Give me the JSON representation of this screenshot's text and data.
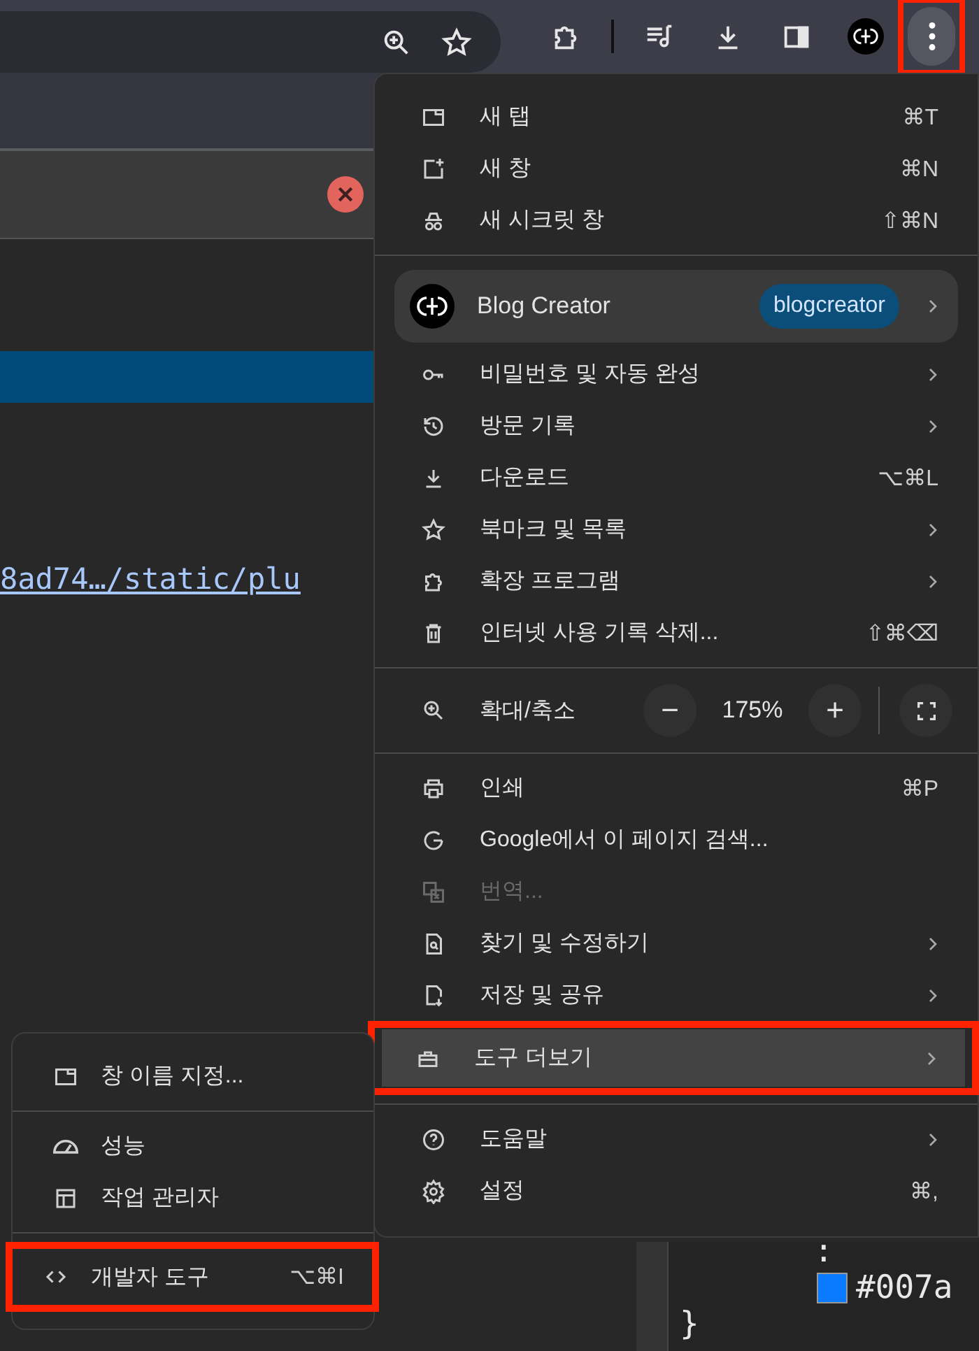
{
  "toolbar": {
    "menu_button": {
      "annotated": true
    }
  },
  "page": {
    "link_text": "8ad74…/static/plu",
    "code_lines": [
      ":",
      "#007a",
      "}"
    ]
  },
  "menu": {
    "sections": [
      {
        "items": [
          {
            "kind": "item",
            "label": "새 탭",
            "shortcut": "⌘T",
            "submenu": false,
            "disabled": false,
            "highlighted": false,
            "annotated": false
          },
          {
            "kind": "item",
            "label": "새 창",
            "shortcut": "⌘N",
            "submenu": false,
            "disabled": false,
            "highlighted": false,
            "annotated": false
          },
          {
            "kind": "item",
            "label": "새 시크릿 창",
            "shortcut": "⇧⌘N",
            "submenu": false,
            "disabled": false,
            "highlighted": false,
            "annotated": false
          }
        ]
      },
      {
        "items": [
          {
            "kind": "profile",
            "label": "Blog Creator",
            "badge": "blogcreator",
            "submenu": true
          },
          {
            "kind": "item",
            "label": "비밀번호 및 자동 완성",
            "submenu": true,
            "disabled": false,
            "highlighted": false,
            "annotated": false
          },
          {
            "kind": "item",
            "label": "방문 기록",
            "submenu": true,
            "disabled": false,
            "highlighted": false,
            "annotated": false
          },
          {
            "kind": "item",
            "label": "다운로드",
            "shortcut": "⌥⌘L",
            "submenu": false,
            "disabled": false,
            "highlighted": false,
            "annotated": false
          },
          {
            "kind": "item",
            "label": "북마크 및 목록",
            "submenu": true,
            "disabled": false,
            "highlighted": false,
            "annotated": false
          },
          {
            "kind": "item",
            "label": "확장 프로그램",
            "submenu": true,
            "disabled": false,
            "highlighted": false,
            "annotated": false
          },
          {
            "kind": "item",
            "label": "인터넷 사용 기록 삭제...",
            "shortcut": "⇧⌘⌫",
            "submenu": false,
            "disabled": false,
            "highlighted": false,
            "annotated": false
          }
        ]
      },
      {
        "items": [
          {
            "kind": "zoom",
            "label": "확대/축소",
            "minus": "−",
            "value": "175%",
            "plus": "+"
          }
        ]
      },
      {
        "items": [
          {
            "kind": "item",
            "label": "인쇄",
            "shortcut": "⌘P",
            "submenu": false,
            "disabled": false,
            "highlighted": false,
            "annotated": false
          },
          {
            "kind": "item",
            "label": "Google에서 이 페이지 검색...",
            "submenu": false,
            "disabled": false,
            "highlighted": false,
            "annotated": false
          },
          {
            "kind": "item",
            "label": "번역...",
            "submenu": false,
            "disabled": true,
            "highlighted": false,
            "annotated": false
          },
          {
            "kind": "item",
            "label": "찾기 및 수정하기",
            "submenu": true,
            "disabled": false,
            "highlighted": false,
            "annotated": false
          },
          {
            "kind": "item",
            "label": "저장 및 공유",
            "submenu": true,
            "disabled": false,
            "highlighted": false,
            "annotated": false
          },
          {
            "kind": "item",
            "label": "도구 더보기",
            "submenu": true,
            "disabled": false,
            "highlighted": true,
            "annotated": true
          }
        ]
      },
      {
        "items": [
          {
            "kind": "item",
            "label": "도움말",
            "submenu": true,
            "disabled": false,
            "highlighted": false,
            "annotated": false
          },
          {
            "kind": "item",
            "label": "설정",
            "shortcut": "⌘,",
            "submenu": false,
            "disabled": false,
            "highlighted": false,
            "annotated": false
          }
        ]
      }
    ]
  },
  "submenu": {
    "sections": [
      {
        "items": [
          {
            "kind": "item",
            "label": "창 이름 지정...",
            "annotated": false
          }
        ]
      },
      {
        "items": [
          {
            "kind": "item",
            "label": "성능",
            "annotated": false
          },
          {
            "kind": "item",
            "label": "작업 관리자",
            "annotated": false
          }
        ]
      },
      {
        "items": [
          {
            "kind": "item",
            "label": "개발자 도구",
            "shortcut": "⌥⌘I",
            "annotated": true
          }
        ]
      }
    ]
  }
}
